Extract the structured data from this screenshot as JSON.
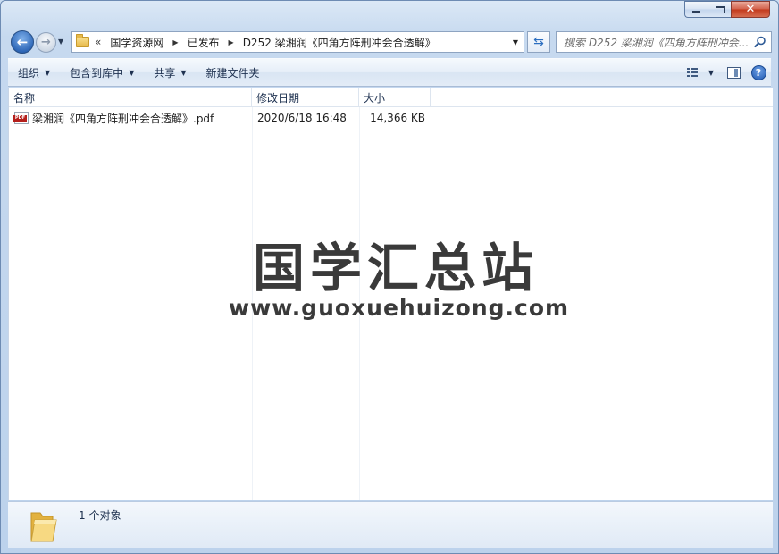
{
  "window": {
    "caption": {
      "minimize": "minimize",
      "maximize": "maximize",
      "close": "✕"
    }
  },
  "nav": {
    "back_arrow": "←",
    "forward_arrow": "→",
    "breadcrumb": {
      "overflow": "«",
      "items": [
        "国学资源网",
        "已发布",
        "D252 梁湘润《四角方阵刑冲会合透解》"
      ]
    },
    "refresh_glyph": "⇆",
    "search": {
      "placeholder": "搜索 D252 梁湘润《四角方阵刑冲会..."
    }
  },
  "toolbar": {
    "organize": "组织",
    "include_library": "包含到库中",
    "share": "共享",
    "new_folder": "新建文件夹",
    "help": "?"
  },
  "columns": {
    "name": "名称",
    "date": "修改日期",
    "size": "大小"
  },
  "files": [
    {
      "name": "梁湘润《四角方阵刑冲会合透解》.pdf",
      "date": "2020/6/18 16:48",
      "size": "14,366 KB",
      "icon": "pdf-file-icon",
      "icon_label": "PDF"
    }
  ],
  "watermark": {
    "title": "国学汇总站",
    "url": "www.guoxuehuizong.com"
  },
  "details": {
    "summary": "1 个对象"
  },
  "colors": {
    "accent": "#2f68b8",
    "close_red": "#c2391c",
    "pdf_red": "#b5201c",
    "folder_yellow": "#e7b94a"
  }
}
